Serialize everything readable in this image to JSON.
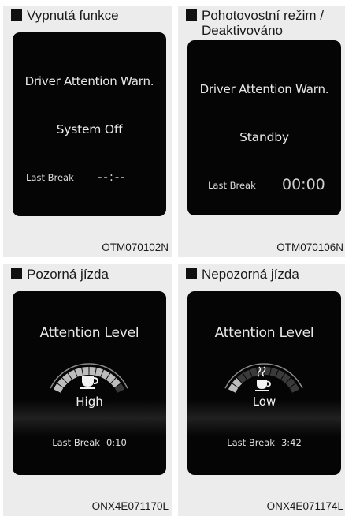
{
  "panels": [
    {
      "heading": "Vypnutá funkce",
      "screen": {
        "title": "Driver Attention Warn.",
        "state": "System Off",
        "last_break_label": "Last Break",
        "last_break_value": "--:--"
      },
      "code": "OTM070102N"
    },
    {
      "heading": "Pohotovostní režim / Deaktivováno",
      "screen": {
        "title": "Driver Attention Warn.",
        "state": "Standby",
        "last_break_label": "Last Break",
        "last_break_value": "00:00"
      },
      "code": "OTM070106N"
    },
    {
      "heading": "Pozorná jízda",
      "screen": {
        "title": "Attention Level",
        "level": "High",
        "gauge_fill": 0.95,
        "last_break_label": "Last Break",
        "last_break_value": "0:10"
      },
      "code": "ONX4E071170L"
    },
    {
      "heading": "Nepozorná jízda",
      "screen": {
        "title": "Attention Level",
        "level": "Low",
        "gauge_fill": 0.2,
        "last_break_label": "Last Break",
        "last_break_value": "3:42"
      },
      "code": "ONX4E071174L"
    }
  ],
  "icons": [
    "coffee-cup-icon",
    "steaming-coffee-cup-icon"
  ]
}
